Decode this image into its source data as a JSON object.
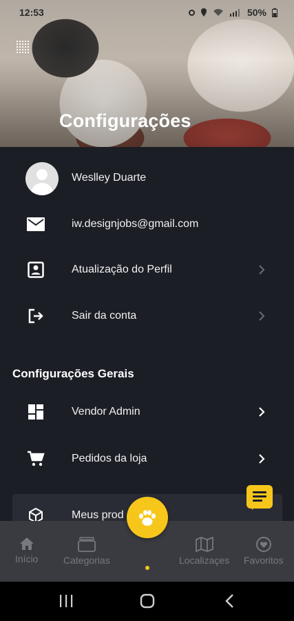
{
  "status_bar": {
    "time": "12:53",
    "battery": "50%",
    "icons": [
      "alarm-icon",
      "location-icon",
      "wifi-icon",
      "signal-icon",
      "battery-icon"
    ]
  },
  "header": {
    "title": "Configurações"
  },
  "account": {
    "name": "Weslley Duarte",
    "email": "iw.designjobs@gmail.com",
    "profile_update": "Atualização do Perfil",
    "logout": "Sair da conta"
  },
  "general": {
    "section_title": "Configurações Gerais",
    "vendor_admin": "Vendor Admin",
    "store_orders": "Pedidos da loja",
    "my_products": "Meus prod"
  },
  "bottom_nav": {
    "items": [
      {
        "label": "Início",
        "icon": "home-icon"
      },
      {
        "label": "Categorias",
        "icon": "categories-icon"
      },
      {
        "label": "Localizaçes",
        "icon": "map-icon"
      },
      {
        "label": "Favoritos",
        "icon": "heart-icon"
      }
    ],
    "center_icon": "paw-icon"
  },
  "colors": {
    "accent": "#f7c61b",
    "background": "#1c1e26",
    "nav_background": "#3a3b40"
  }
}
